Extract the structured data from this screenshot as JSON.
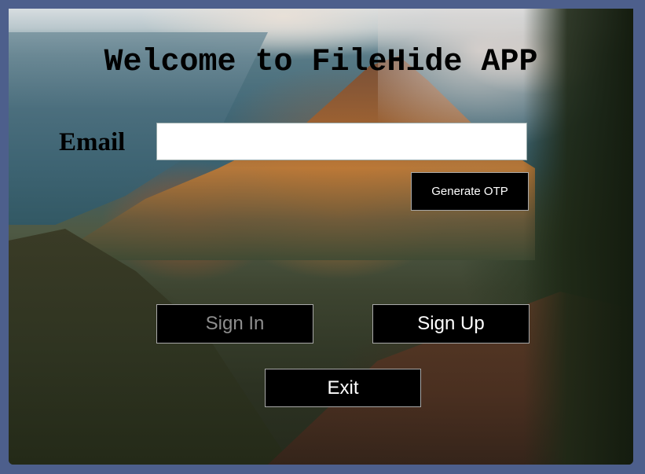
{
  "app": {
    "title": "Welcome to FileHide APP"
  },
  "form": {
    "email_label": "Email",
    "email_value": "",
    "generate_otp_label": "Generate OTP"
  },
  "actions": {
    "sign_in_label": "Sign In",
    "sign_up_label": "Sign Up",
    "exit_label": "Exit"
  },
  "colors": {
    "window_frame": "#4d5f8c",
    "button_bg": "#000000",
    "button_text": "#ffffff",
    "disabled_text": "#8e8e8e"
  }
}
